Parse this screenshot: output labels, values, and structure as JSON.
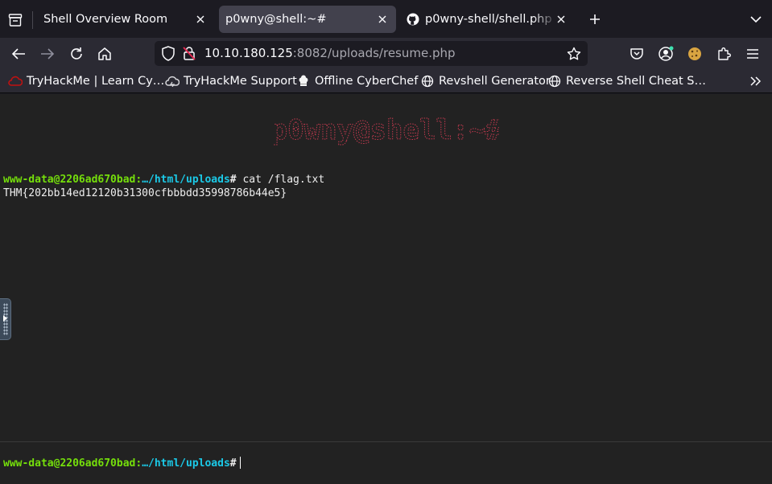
{
  "tabs": [
    {
      "title": "Shell Overview Room",
      "active": false
    },
    {
      "title": "p0wny@shell:~#",
      "active": true
    },
    {
      "title": "p0wny-shell/shell.php at",
      "active": false
    }
  ],
  "address": {
    "host": "10.10.180.125",
    "path": ":8082/uploads/resume.php"
  },
  "bookmarks": [
    {
      "label": "TryHackMe | Learn Cy…",
      "icon": "tryhackme-icon"
    },
    {
      "label": "TryHackMe Support",
      "icon": "cloud-icon"
    },
    {
      "label": "Offline CyberChef",
      "icon": "chef-hat-icon"
    },
    {
      "label": "Revshell Generator",
      "icon": "globe-icon"
    },
    {
      "label": "Reverse Shell Cheat S…",
      "icon": "globe-icon"
    }
  ],
  "shell": {
    "banner": "p0wny@shell:~#",
    "prompt_user": "www-data@2206ad670bad",
    "prompt_sep": ":",
    "prompt_path": "…/html/uploads",
    "prompt_hash": "#",
    "command": "cat /flag.txt",
    "output": "THM{202bb14ed12120b31300cfbbbdd35998786b44e5}"
  },
  "colors": {
    "prompt_user": "#75df0b",
    "prompt_path": "#1bc9e7",
    "banner": "#c53a4f"
  }
}
